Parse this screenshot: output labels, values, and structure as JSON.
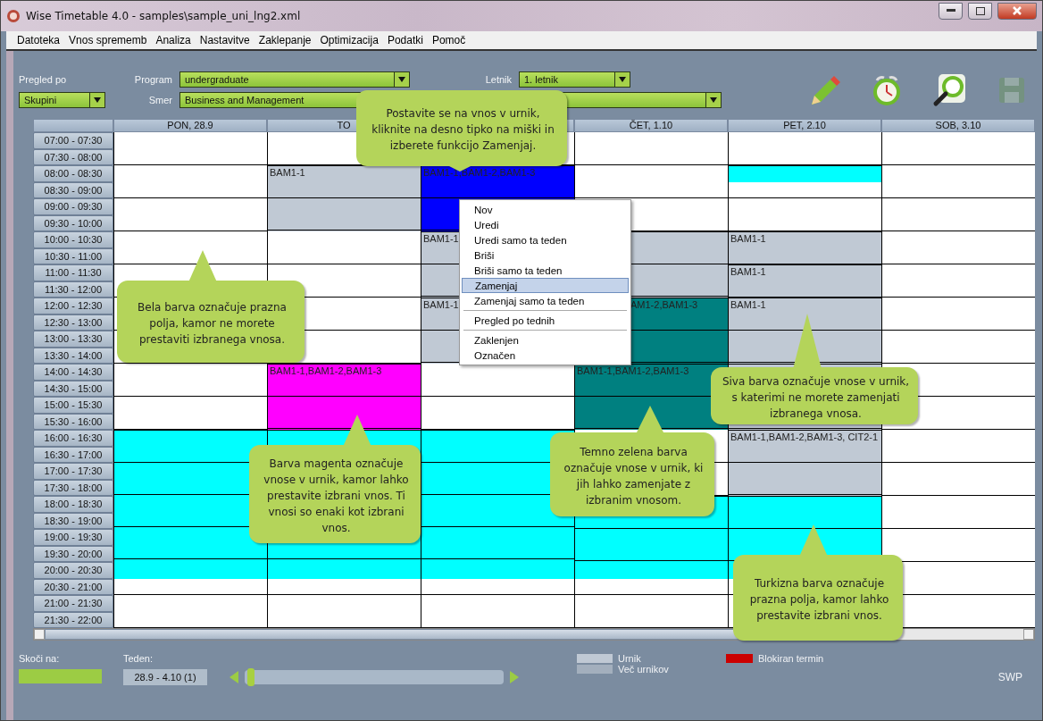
{
  "window": {
    "title": "Wise Timetable 4.0 - samples\\sample_uni_lng2.xml"
  },
  "menu": [
    "Datoteka",
    "Vnos sprememb",
    "Analiza",
    "Nastavitve",
    "Zaklepanje",
    "Optimizacija",
    "Podatki",
    "Pomoč"
  ],
  "filters": {
    "view_label": "Pregled po",
    "view_value": "Skupini",
    "program_label": "Program",
    "program_value": "undergraduate",
    "year_label": "Letnik",
    "year_value": "1. letnik",
    "direction_label": "Smer",
    "direction_value": "Business and Management"
  },
  "toolbar": {
    "save_disabled": true
  },
  "slots": [
    "07:00 - 07:30",
    "07:30 - 08:00",
    "08:00 - 08:30",
    "08:30 - 09:00",
    "09:00 - 09:30",
    "09:30 - 10:00",
    "10:00 - 10:30",
    "10:30 - 11:00",
    "11:00 - 11:30",
    "11:30 - 12:00",
    "12:00 - 12:30",
    "12:30 - 13:00",
    "13:00 - 13:30",
    "13:30 - 14:00",
    "14:00 - 14:30",
    "14:30 - 15:00",
    "15:00 - 15:30",
    "15:30 - 16:00",
    "16:00 - 16:30",
    "16:30 - 17:00",
    "17:00 - 17:30",
    "17:30 - 18:00",
    "18:00 - 18:30",
    "18:30 - 19:00",
    "19:00 - 19:30",
    "19:30 - 20:00",
    "20:00 - 20:30",
    "20:30 - 21:00",
    "21:00 - 21:30",
    "21:30 - 22:00"
  ],
  "days": [
    {
      "label": "PON, 28.9",
      "blocks": [
        {
          "color": "#00ffff"
        }
      ]
    },
    {
      "label": "TO",
      "blocks": [
        {
          "color": "#c0c9d4",
          "text": "BAM1-1"
        },
        {
          "color": "#ff00ff",
          "text": "BAM1-1,BAM1-2,BAM1-3"
        },
        {
          "color": "#00ffff"
        }
      ]
    },
    {
      "blocks": [
        {
          "color": "#0000ff",
          "text": "BAM1-1,BAM1-2,BAM1-3"
        },
        {
          "color": "#c0c9d4",
          "text": "BAM1-1"
        },
        {
          "color": "#c0c9d4",
          "text": "BAM1-1"
        },
        {
          "color": "#00ffff"
        }
      ]
    },
    {
      "label": "ČET, 1.10",
      "blocks": [
        {
          "color": "#c0c9d4"
        },
        {
          "color": "#008080",
          "text": "AM1-2,BAM1-3"
        },
        {
          "color": "#008080",
          "text": "BAM1-1,BAM1-2,BAM1-3"
        },
        {
          "color": "#00ffff"
        }
      ]
    },
    {
      "label": "PET, 2.10",
      "blocks": [
        {
          "color": "#00ffff"
        },
        {
          "color": "#c0c9d4",
          "text": "BAM1-1"
        },
        {
          "color": "#c0c9d4",
          "text": "BAM1-1"
        },
        {
          "color": "#c0c9d4",
          "text": "BAM1-1"
        },
        {
          "color": "#c0c9d4"
        },
        {
          "color": "#c0c9d4",
          "text": "BAM1-1,BAM1-2,BAM1-3, CIT2-1"
        },
        {
          "color": "#00ffff"
        }
      ]
    },
    {
      "label": "SOB, 3.10"
    }
  ],
  "context_menu": [
    {
      "label": "Nov",
      "selected": false,
      "separator_after": false
    },
    {
      "label": "Uredi",
      "selected": false,
      "separator_after": false
    },
    {
      "label": "Uredi samo ta teden",
      "selected": false,
      "separator_after": false
    },
    {
      "label": "Briši",
      "selected": false,
      "separator_after": false
    },
    {
      "label": "Briši samo ta teden",
      "selected": false,
      "separator_after": false
    },
    {
      "label": "Zamenjaj",
      "selected": true,
      "separator_after": false
    },
    {
      "label": "Zamenjaj samo ta teden",
      "selected": false,
      "separator_after": true
    },
    {
      "label": "Pregled po tednih",
      "selected": false,
      "separator_after": true
    },
    {
      "label": "Zaklenjen",
      "selected": false,
      "separator_after": false
    },
    {
      "label": "Označen",
      "selected": false,
      "separator_after": false
    }
  ],
  "callouts": [
    "Postavite se na vnos v urnik, kliknite na desno tipko na miški in izberete funkcijo Zamenjaj.",
    "Bela barva označuje prazna polja, kamor ne morete prestaviti izbranega vnosa.",
    "Siva barva označuje vnose v urnik, s katerimi ne morete zamenjati izbranega vnosa.",
    "Barva magenta označuje vnose v urnik, kamor lahko prestavite izbrani vnos. Ti vnosi so enaki kot izbrani vnos.",
    "Temno zelena barva označuje vnose v urnik, ki jih lahko zamenjate z izbranim vnosom.",
    "Turkizna barva označuje prazna polja, kamor lahko prestavite izbrani vnos."
  ],
  "footer": {
    "jump_label": "Skoči na:",
    "week_label": "Teden:",
    "week_value": "28.9 - 4.10 (1)",
    "week_slider": {
      "level": 0.01
    },
    "legend": [
      {
        "label": "Urnik",
        "color": "#c0c9d4"
      },
      {
        "label": "Več urnikov",
        "color": "#a3afbd"
      },
      {
        "label": "Blokiran termin",
        "color": "#cc0000"
      }
    ],
    "mode": "SWP"
  }
}
